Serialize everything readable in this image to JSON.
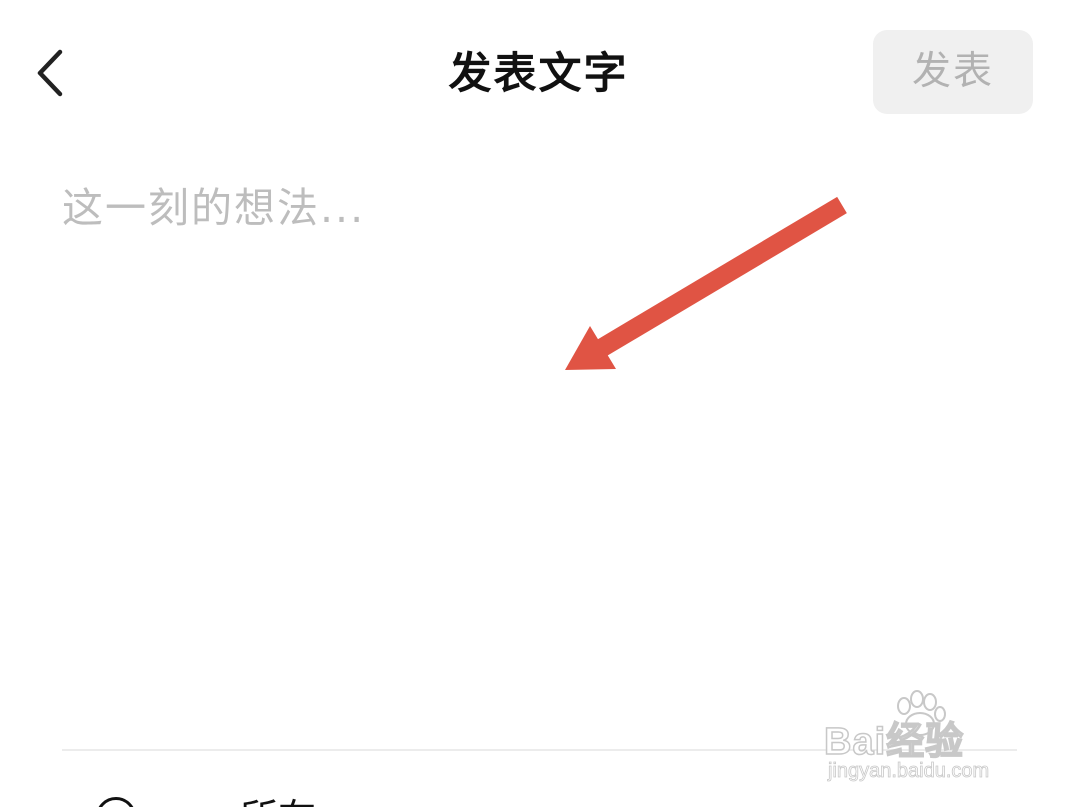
{
  "header": {
    "title": "发表文字",
    "publish_label": "发表",
    "back_icon": "chevron-left-icon"
  },
  "composer": {
    "placeholder": "这一刻的想法...",
    "value": ""
  },
  "annotation": {
    "type": "arrow",
    "color": "#e05444"
  },
  "bottom": {
    "icon": "location-icon",
    "label": "所在"
  },
  "watermark": {
    "brand": "Bai经验",
    "url": "jingyan.baidu.com"
  },
  "colors": {
    "publish_button_bg": "#f0f0f0",
    "publish_button_text": "#b2b2b2",
    "placeholder": "#bdbdbd",
    "title": "#111111"
  }
}
